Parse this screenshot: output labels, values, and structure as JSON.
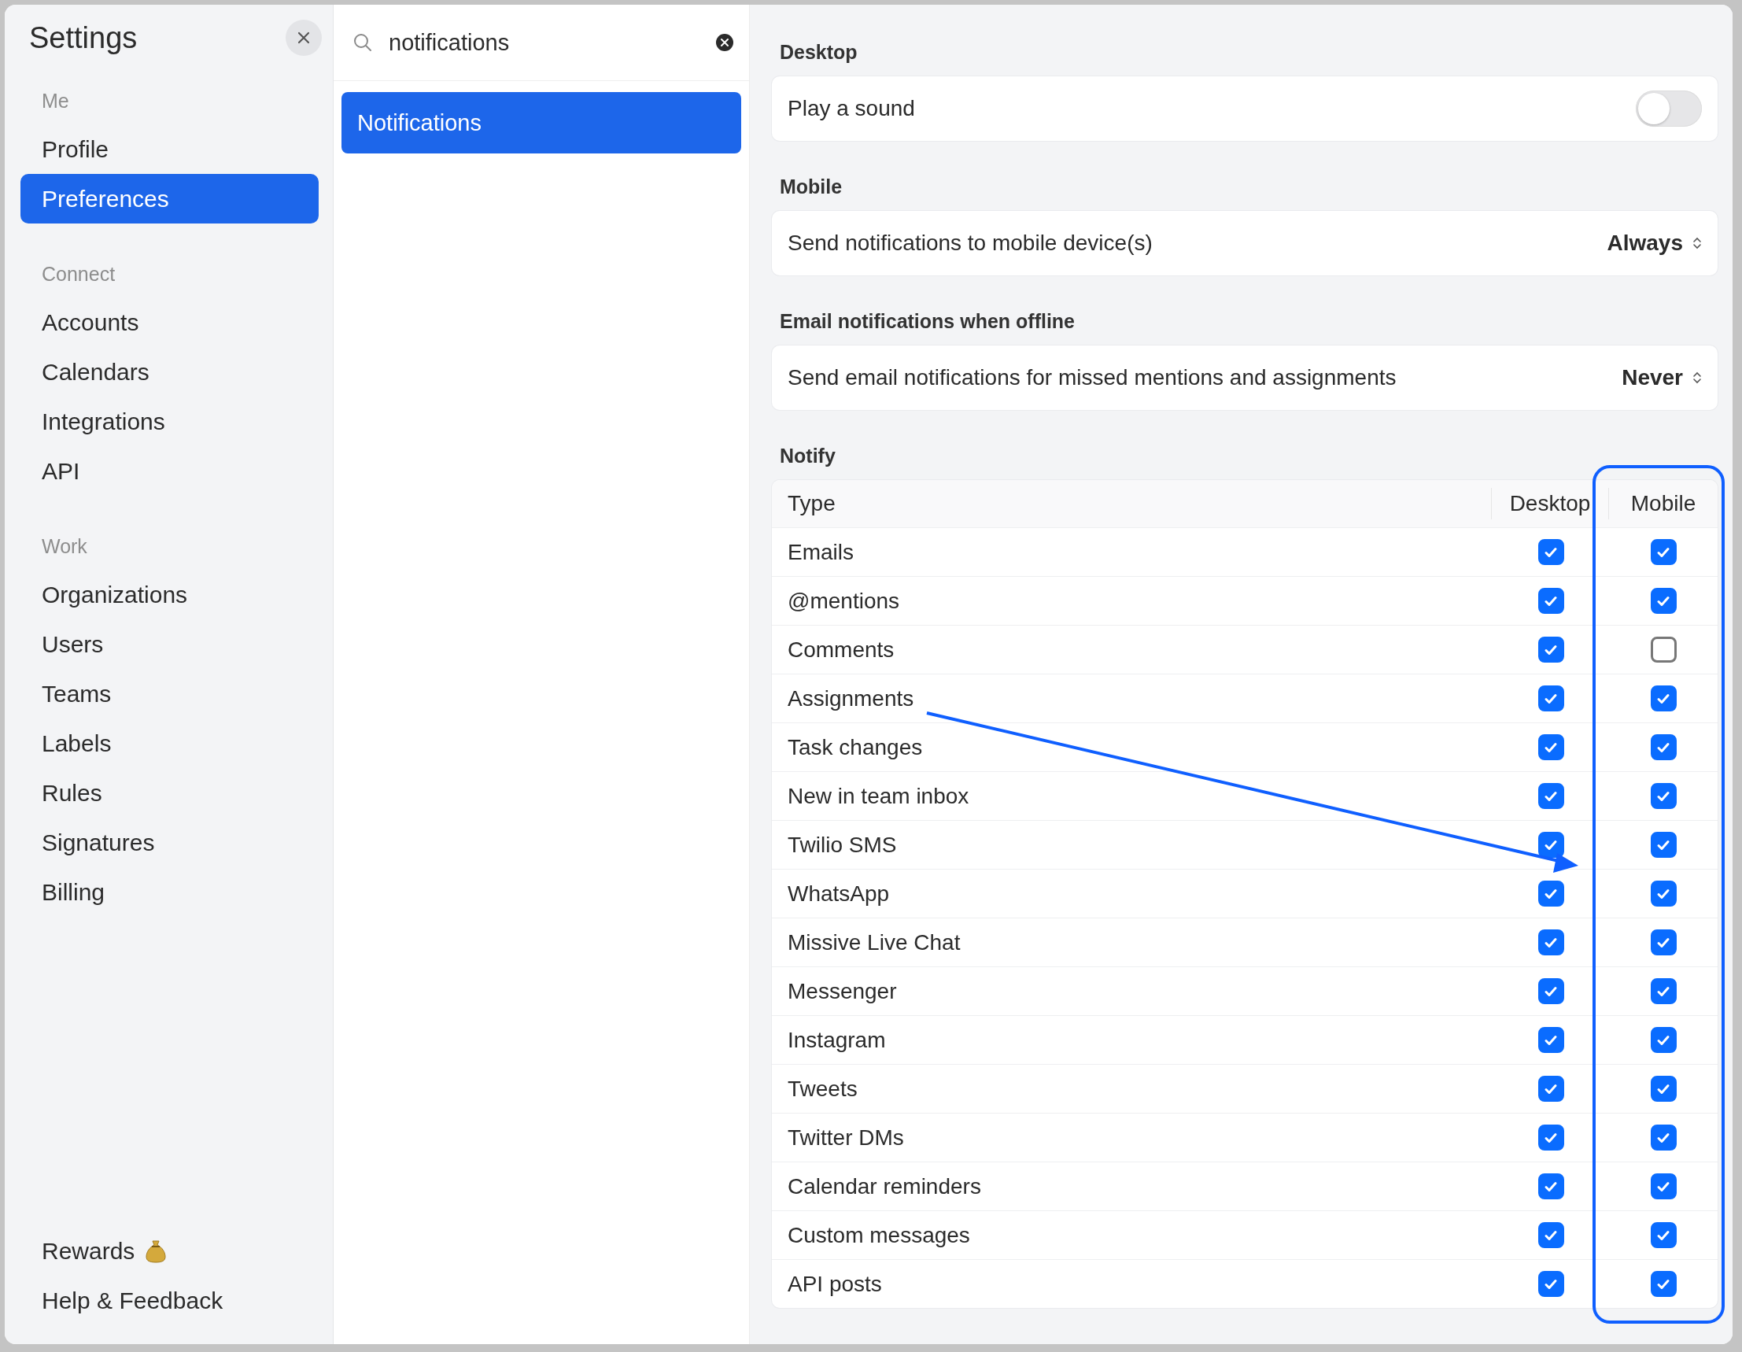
{
  "window": {
    "title": "Settings"
  },
  "sidebar": {
    "sections": [
      {
        "heading": "Me",
        "items": [
          {
            "label": "Profile",
            "selected": false
          },
          {
            "label": "Preferences",
            "selected": true
          }
        ]
      },
      {
        "heading": "Connect",
        "items": [
          {
            "label": "Accounts",
            "selected": false
          },
          {
            "label": "Calendars",
            "selected": false
          },
          {
            "label": "Integrations",
            "selected": false
          },
          {
            "label": "API",
            "selected": false
          }
        ]
      },
      {
        "heading": "Work",
        "items": [
          {
            "label": "Organizations",
            "selected": false
          },
          {
            "label": "Users",
            "selected": false
          },
          {
            "label": "Teams",
            "selected": false
          },
          {
            "label": "Labels",
            "selected": false
          },
          {
            "label": "Rules",
            "selected": false
          },
          {
            "label": "Signatures",
            "selected": false
          },
          {
            "label": "Billing",
            "selected": false
          }
        ]
      }
    ],
    "footer_items": [
      {
        "label": "Rewards",
        "kind": "rewards"
      },
      {
        "label": "Help & Feedback",
        "kind": "plain"
      }
    ]
  },
  "search": {
    "value": "notifications"
  },
  "results": [
    {
      "label": "Notifications",
      "selected": true
    }
  ],
  "groups": [
    {
      "heading": "Desktop",
      "kind": "toggle",
      "label": "Play a sound",
      "on": false
    },
    {
      "heading": "Mobile",
      "kind": "select",
      "label": "Send notifications to mobile device(s)",
      "value": "Always"
    },
    {
      "heading": "Email notifications when offline",
      "kind": "select",
      "label": "Send email notifications for missed mentions and assignments",
      "value": "Never"
    }
  ],
  "notify": {
    "heading": "Notify",
    "columns": [
      "Type",
      "Desktop",
      "Mobile"
    ],
    "rows": [
      {
        "type": "Emails",
        "desktop": true,
        "mobile": true
      },
      {
        "type": "@mentions",
        "desktop": true,
        "mobile": true
      },
      {
        "type": "Comments",
        "desktop": true,
        "mobile": false
      },
      {
        "type": "Assignments",
        "desktop": true,
        "mobile": true
      },
      {
        "type": "Task changes",
        "desktop": true,
        "mobile": true
      },
      {
        "type": "New in team inbox",
        "desktop": true,
        "mobile": true
      },
      {
        "type": "Twilio SMS",
        "desktop": true,
        "mobile": true
      },
      {
        "type": "WhatsApp",
        "desktop": true,
        "mobile": true
      },
      {
        "type": "Missive Live Chat",
        "desktop": true,
        "mobile": true
      },
      {
        "type": "Messenger",
        "desktop": true,
        "mobile": true
      },
      {
        "type": "Instagram",
        "desktop": true,
        "mobile": true
      },
      {
        "type": "Tweets",
        "desktop": true,
        "mobile": true
      },
      {
        "type": "Twitter DMs",
        "desktop": true,
        "mobile": true
      },
      {
        "type": "Calendar reminders",
        "desktop": true,
        "mobile": true
      },
      {
        "type": "Custom messages",
        "desktop": true,
        "mobile": true
      },
      {
        "type": "API posts",
        "desktop": true,
        "mobile": true
      }
    ]
  }
}
